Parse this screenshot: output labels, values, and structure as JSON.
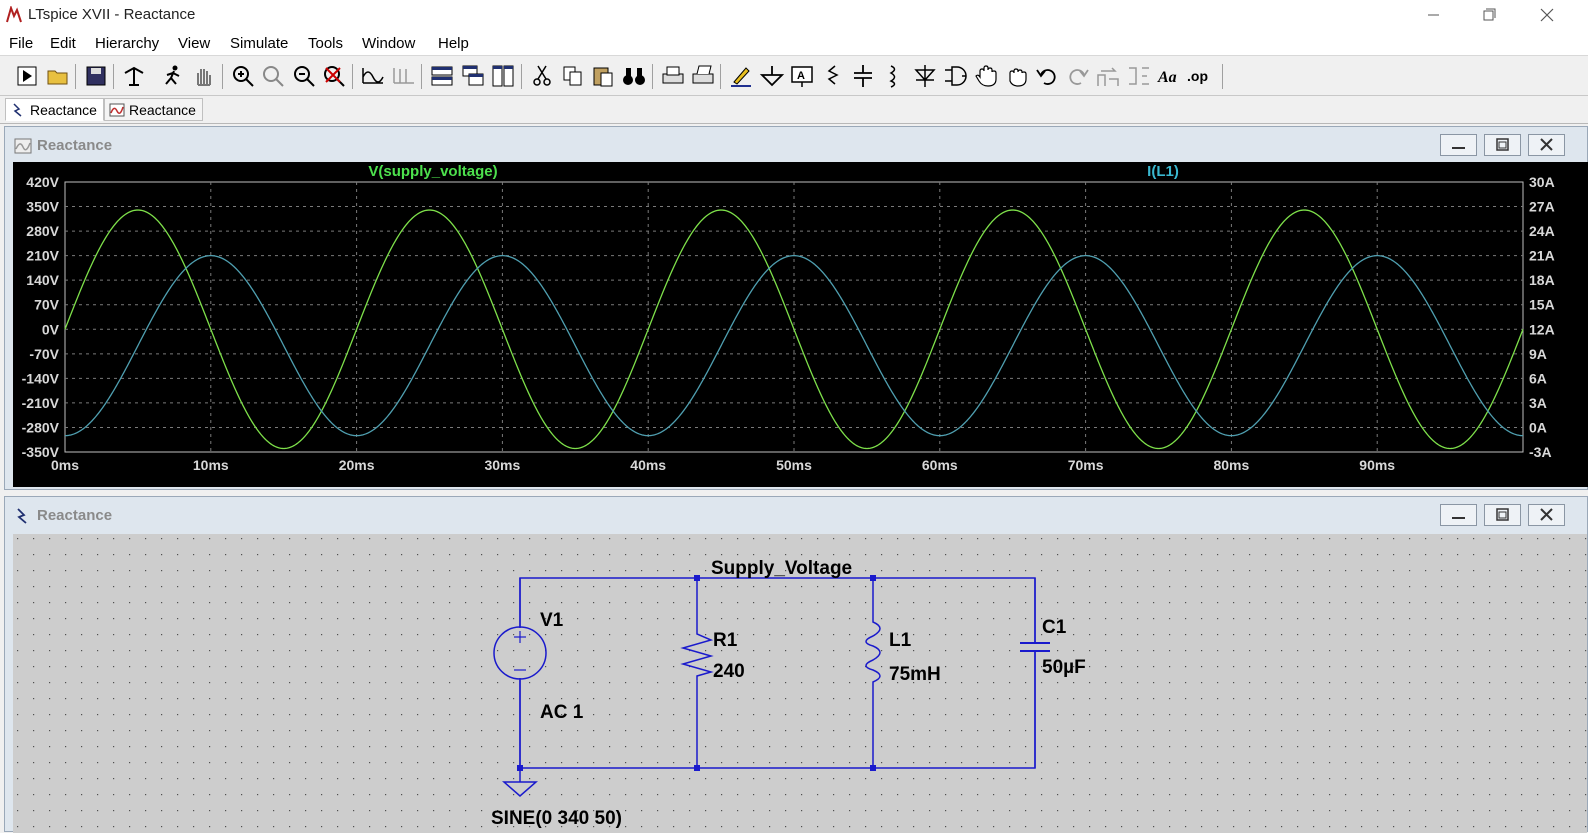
{
  "window": {
    "title": "LTspice XVII - Reactance"
  },
  "menu": [
    {
      "label": "File"
    },
    {
      "label": "Edit"
    },
    {
      "label": "Hierarchy"
    },
    {
      "label": "View"
    },
    {
      "label": "Simulate"
    },
    {
      "label": "Tools"
    },
    {
      "label": "Window"
    },
    {
      "label": "Help"
    }
  ],
  "toolbar": {
    "icons": [
      "run-icon",
      "open-icon",
      "save-icon",
      "control-panel-icon",
      "halt-icon",
      "pan-icon",
      "zoom-in-icon",
      "zoom-area-icon",
      "zoom-out-icon",
      "zoom-cancel-icon",
      "autorange-icon",
      "mark-icon",
      "tile-horizontal-icon",
      "cascade-icon",
      "tile-vertical-icon",
      "cut-icon",
      "copy-icon",
      "paste-icon",
      "find-icon",
      "print-preview-icon",
      "print-icon",
      "draw-wire-icon",
      "ground-icon",
      "label-net-icon",
      "resistor-icon",
      "capacitor-icon",
      "inductor-icon",
      "diode-icon",
      "component-icon",
      "move-icon",
      "drag-icon",
      "undo-icon",
      "redo-icon",
      "rotate-icon",
      "mirror-icon",
      "text-icon",
      "spice-directive-icon"
    ],
    "text_label": "Aa",
    "op_label": ".op"
  },
  "tabs": [
    {
      "label": "Reactance",
      "icon": "schematic-icon",
      "active": true
    },
    {
      "label": "Reactance",
      "icon": "waveform-icon",
      "active": false
    }
  ],
  "waveform_window": {
    "title": "Reactance",
    "icon": "waveform-icon"
  },
  "schematic_window": {
    "title": "Reactance",
    "icon": "schematic-icon"
  },
  "chart_data": {
    "type": "line",
    "x_ticks": [
      "0ms",
      "10ms",
      "20ms",
      "30ms",
      "40ms",
      "50ms",
      "60ms",
      "70ms",
      "80ms",
      "90ms"
    ],
    "xlim": [
      0,
      100
    ],
    "x_unit": "ms",
    "left_axis": {
      "ticks": [
        "420V",
        "350V",
        "280V",
        "210V",
        "140V",
        "70V",
        "0V",
        "-70V",
        "-140V",
        "-210V",
        "-280V",
        "-350V"
      ],
      "ylim": [
        -350,
        420
      ]
    },
    "right_axis": {
      "ticks": [
        "30A",
        "27A",
        "24A",
        "21A",
        "18A",
        "15A",
        "12A",
        "9A",
        "6A",
        "3A",
        "0A",
        "-3A"
      ],
      "ylim": [
        -3,
        30
      ]
    },
    "grid": true,
    "series": [
      {
        "name": "V(supply_voltage)",
        "axis": "left",
        "color": "#7ee04a",
        "label_color": "#4de04d",
        "amplitude": 340,
        "offset": 0,
        "frequency_hz": 50,
        "phase_deg": 0
      },
      {
        "name": "I(L1)",
        "axis": "right",
        "color": "#4f9fb0",
        "label_color": "#3ab8d0",
        "amplitude": 11.0,
        "offset": 10.0,
        "frequency_hz": 50,
        "phase_deg": -90
      }
    ]
  },
  "schematic": {
    "net_label": "Supply_Voltage",
    "components": [
      {
        "ref": "V1",
        "value": "AC 1",
        "extra": "SINE(0 340 50)"
      },
      {
        "ref": "R1",
        "value": "240"
      },
      {
        "ref": "L1",
        "value": "75mH"
      },
      {
        "ref": "C1",
        "value": "50µF"
      }
    ]
  },
  "colors": {
    "wire": "#1a1acc",
    "node": "#1a1acc",
    "plot_bg": "#000000",
    "grid": "#8a8a8a",
    "schematic_bg": "#cdcdcd"
  }
}
